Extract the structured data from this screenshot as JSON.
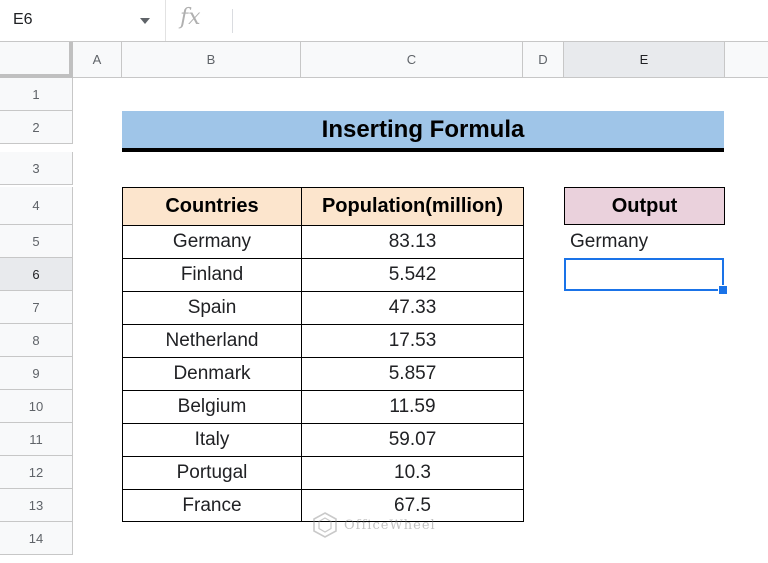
{
  "name_box": {
    "ref": "E6"
  },
  "formula_bar": {
    "fx_label": "fx",
    "formula": ""
  },
  "columns": [
    "A",
    "B",
    "C",
    "D",
    "E"
  ],
  "selected_column": "E",
  "rows": [
    "1",
    "2",
    "3",
    "4",
    "5",
    "6",
    "7",
    "8",
    "9",
    "10",
    "11",
    "12",
    "13",
    "14"
  ],
  "selected_row": "6",
  "title": "Inserting Formula",
  "table": {
    "headers": [
      "Countries",
      "Population(million)"
    ],
    "rows": [
      [
        "Germany",
        "83.13"
      ],
      [
        "Finland",
        "5.542"
      ],
      [
        "Spain",
        "47.33"
      ],
      [
        "Netherland",
        "17.53"
      ],
      [
        "Denmark",
        "5.857"
      ],
      [
        "Belgium",
        "11.59"
      ],
      [
        "Italy",
        "59.07"
      ],
      [
        "Portugal",
        "10.3"
      ],
      [
        "France",
        "67.5"
      ]
    ]
  },
  "output": {
    "header": "Output",
    "value": "Germany"
  },
  "watermark": {
    "text": "OfficeWheel"
  },
  "colors": {
    "title_fill": "#9fc5e8",
    "table_header_fill": "#fce5cd",
    "output_header_fill": "#ead1dc",
    "selection": "#1a73e8"
  }
}
